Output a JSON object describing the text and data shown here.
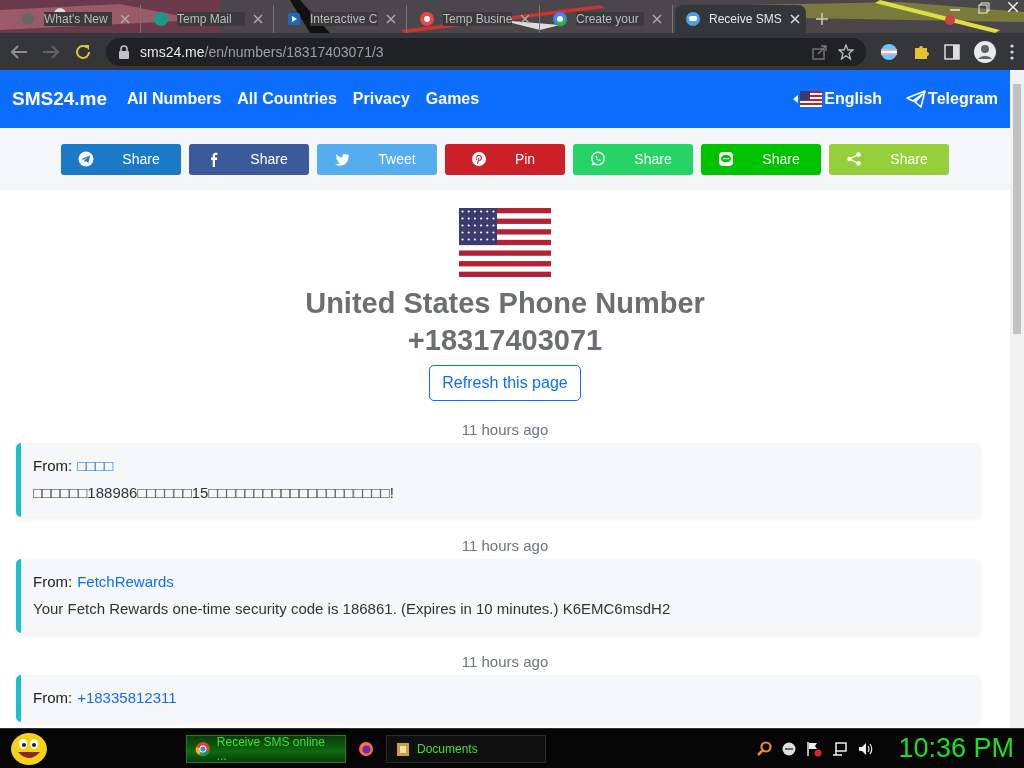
{
  "browser": {
    "tabs": [
      {
        "title": "What's New",
        "selected": false
      },
      {
        "title": "Temp Mail",
        "selected": false
      },
      {
        "title": "Interactive C",
        "selected": false
      },
      {
        "title": "Temp Busine",
        "selected": false
      },
      {
        "title": "Create your",
        "selected": false
      },
      {
        "title": "Receive SMS",
        "selected": true
      }
    ],
    "address_host": "sms24.me",
    "address_path": "/en/numbers/18317403071/3"
  },
  "navbar": {
    "brand": "SMS24.me",
    "links": [
      "All Numbers",
      "All Countries",
      "Privacy",
      "Games"
    ],
    "language": "English",
    "telegram": "Telegram"
  },
  "share_buttons": [
    {
      "kind": "telegram",
      "label": "Share",
      "color": "#1b7ac8"
    },
    {
      "kind": "facebook",
      "label": "Share",
      "color": "#3b5a9a"
    },
    {
      "kind": "twitter",
      "label": "Tweet",
      "color": "#55acee"
    },
    {
      "kind": "pinterest",
      "label": "Pin",
      "color": "#cb2027"
    },
    {
      "kind": "whatsapp",
      "label": "Share",
      "color": "#25d366"
    },
    {
      "kind": "line",
      "label": "Share",
      "color": "#00c300"
    },
    {
      "kind": "sharethis",
      "label": "Share",
      "color": "#95d03a"
    }
  ],
  "heading": {
    "title": "United States Phone Number",
    "number": "+18317403071"
  },
  "refresh_button": "Refresh this page",
  "messages": [
    {
      "time": "11 hours ago",
      "from_label": "From:",
      "from": "□□□□",
      "text": "□□□□□□188986□□□□□□15□□□□□□□□□□□□□□□□□□□□!"
    },
    {
      "time": "11 hours ago",
      "from_label": "From:",
      "from": "FetchRewards",
      "text": "Your Fetch Rewards one-time security code is 186861. (Expires in 10 minutes.) K6EMC6msdH2"
    },
    {
      "time": "11 hours ago",
      "from_label": "From:",
      "from": "+18335812311"
    }
  ],
  "taskbar": {
    "items": [
      {
        "kind": "chrome",
        "label": "Receive SMS online ...",
        "selected": true
      },
      {
        "kind": "firefox"
      },
      {
        "kind": "folder",
        "label": "Documents",
        "selected": false
      }
    ],
    "clock": "10:36 PM"
  }
}
